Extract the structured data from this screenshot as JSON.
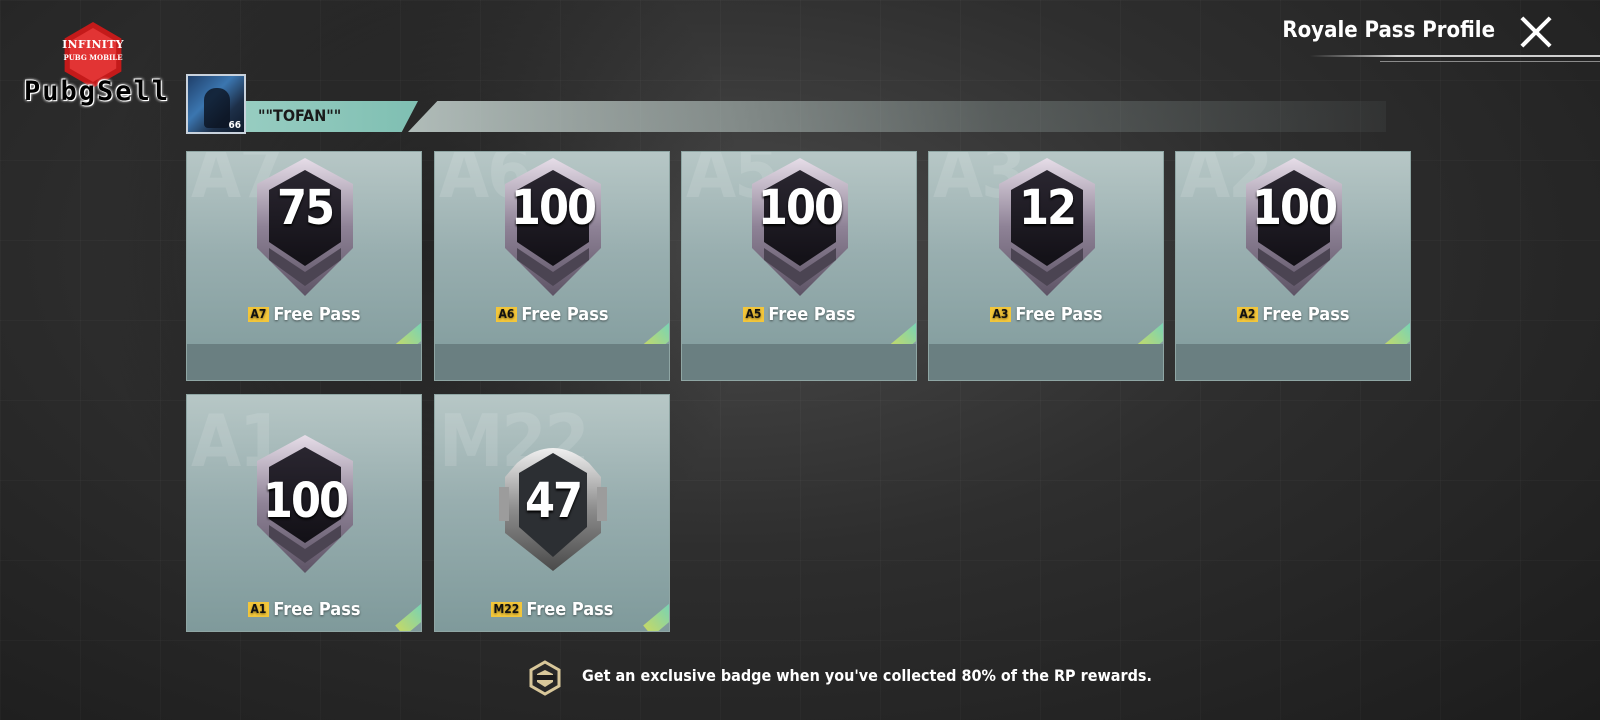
{
  "logo": {
    "line1": "INFINITY",
    "line2": "PUBG MOBILE",
    "word": "PubgSell"
  },
  "header": {
    "title": "Royale Pass Profile",
    "close_icon": "close-icon"
  },
  "player": {
    "name": "\"\"TOFAN\"\"",
    "level": "66",
    "avatar_icon": "avatar-portrait"
  },
  "cards": [
    {
      "watermark": "A7",
      "value": "75",
      "season": "A7",
      "label": "Free Pass"
    },
    {
      "watermark": "A6",
      "value": "100",
      "season": "A6",
      "label": "Free Pass"
    },
    {
      "watermark": "A5",
      "value": "100",
      "season": "A5",
      "label": "Free Pass"
    },
    {
      "watermark": "A3",
      "value": "12",
      "season": "A3",
      "label": "Free Pass"
    },
    {
      "watermark": "A2",
      "value": "100",
      "season": "A2",
      "label": "Free Pass"
    },
    {
      "watermark": "A1",
      "value": "100",
      "season": "A1",
      "label": "Free Pass"
    },
    {
      "watermark": "M22",
      "value": "47",
      "season": "M22",
      "label": "Free Pass"
    }
  ],
  "hint": {
    "text": "Get an exclusive badge when you've collected 80% of the RP rewards.",
    "icon": "badge-emblem-icon"
  },
  "colors": {
    "season_tag": "#f3c63a",
    "card_bg": "#98aeaf",
    "bar_accent": "#9fd1c6"
  }
}
